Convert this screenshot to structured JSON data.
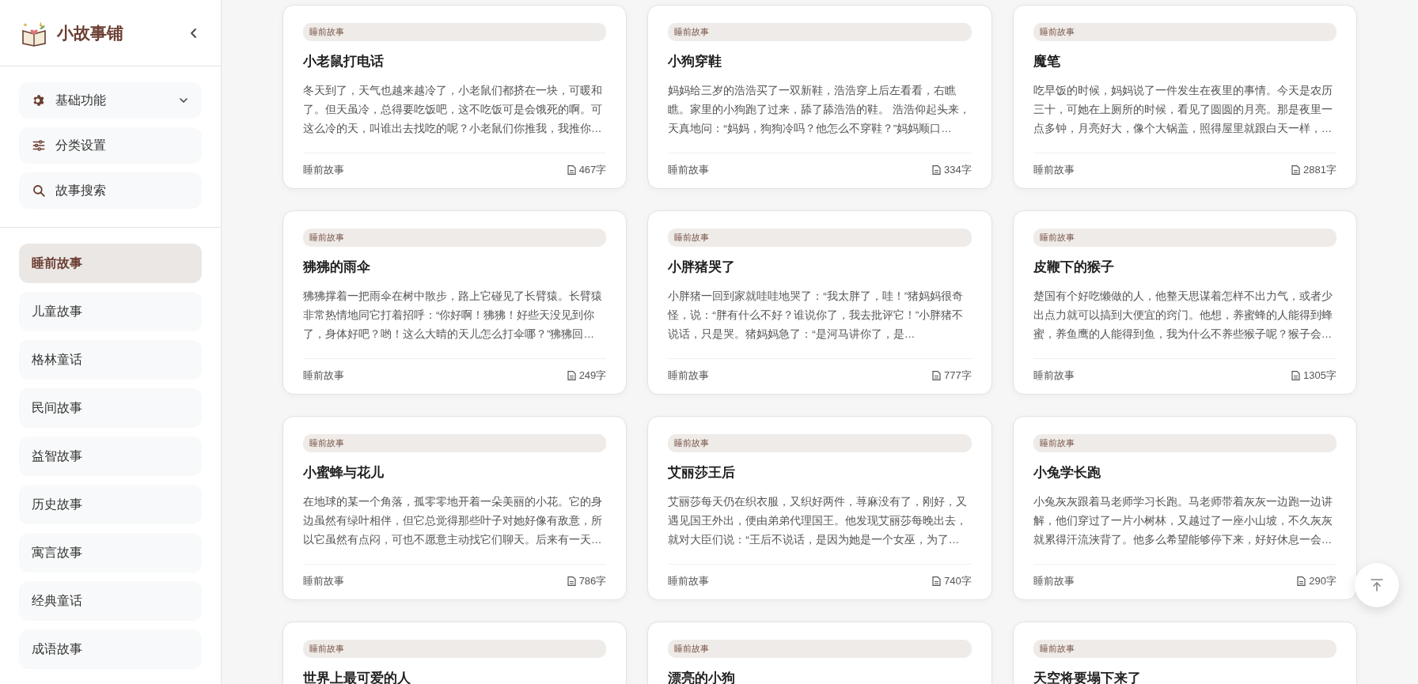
{
  "sidebar": {
    "brand": "小故事铺",
    "menu": [
      {
        "kind": "group",
        "label": "基础功能",
        "expanded": false
      },
      {
        "kind": "link",
        "label": "分类设置"
      },
      {
        "kind": "link",
        "label": "故事搜索"
      }
    ],
    "categories": [
      {
        "label": "睡前故事",
        "selected": true
      },
      {
        "label": "儿童故事",
        "selected": false
      },
      {
        "label": "格林童话",
        "selected": false
      },
      {
        "label": "民间故事",
        "selected": false
      },
      {
        "label": "益智故事",
        "selected": false
      },
      {
        "label": "历史故事",
        "selected": false
      },
      {
        "label": "寓言故事",
        "selected": false
      },
      {
        "label": "经典童话",
        "selected": false
      },
      {
        "label": "成语故事",
        "selected": false
      }
    ]
  },
  "stories": [
    {
      "tag": "睡前故事",
      "title": "小老鼠打电话",
      "excerpt": "冬天到了，天气也越来越冷了，小老鼠们都挤在一块，可暖和了。但天虽冷，总得要吃饭吧，这不吃饭可是会饿死的啊。可这么冷的天，叫谁出去找吃的呢？小老鼠们你推我，我推你…",
      "category": "睡前故事",
      "word_count": "467字"
    },
    {
      "tag": "睡前故事",
      "title": "小狗穿鞋",
      "excerpt": "妈妈给三岁的浩浩买了一双新鞋，浩浩穿上后左看看，右瞧瞧。家里的小狗跑了过来，舔了舔浩浩的鞋。 浩浩仰起头来，天真地问：“妈妈，狗狗冷吗？他怎么不穿鞋？”妈妈顺口…",
      "category": "睡前故事",
      "word_count": "334字"
    },
    {
      "tag": "睡前故事",
      "title": "魔笔",
      "excerpt": "吃早饭的时候，妈妈说了一件发生在夜里的事情。今天是农历三十，可她在上厕所的时候，看见了圆圆的月亮。那是夜里一点多钟，月亮好大，像个大锅盖，照得屋里就跟白天一样，…",
      "category": "睡前故事",
      "word_count": "2881字"
    },
    {
      "tag": "睡前故事",
      "title": "狒狒的雨伞",
      "excerpt": "狒狒撑着一把雨伞在树中散步，路上它碰见了长臂猿。长臂猿非常热情地同它打着招呼：“你好啊！狒狒！好些天没见到你了，身体好吧？哟！这么大晴的天儿怎么打伞哪？”狒狒回…",
      "category": "睡前故事",
      "word_count": "249字"
    },
    {
      "tag": "睡前故事",
      "title": "小胖猪哭了",
      "excerpt": "小胖猪一回到家就哇哇地哭了：“我太胖了，哇！”猪妈妈很奇怪，说：“胖有什么不好？谁说你了，我去批评它！”小胖猪不说话，只是哭。猪妈妈急了：“是河马讲你了，是…",
      "category": "睡前故事",
      "word_count": "777字"
    },
    {
      "tag": "睡前故事",
      "title": "皮鞭下的猴子",
      "excerpt": "楚国有个好吃懒做的人，他整天思谋着怎样不出力气，或者少出点力就可以搞到大便宜的窍门。他想，养蜜蜂的人能得到蜂蜜，养鱼鹰的人能得到鱼，我为什么不养些猴子呢？猴子会…",
      "category": "睡前故事",
      "word_count": "1305字"
    },
    {
      "tag": "睡前故事",
      "title": "小蜜蜂与花儿",
      "excerpt": "在地球的某一个角落，孤零零地开着一朵美丽的小花。它的身边虽然有绿叶相伴，但它总觉得那些叶子对她好像有敌意，所以它虽然有点闷，可也不愿意主动找它们聊天。后来有一天…",
      "category": "睡前故事",
      "word_count": "786字"
    },
    {
      "tag": "睡前故事",
      "title": "艾丽莎王后",
      "excerpt": "艾丽莎每天仍在织衣服，又织好两件，荨麻没有了，刚好，又遇见国王外出，便由弟弟代理国王。他发现艾丽莎每晚出去，就对大臣们说：“王后不说话，是因为她是一个女巫，为了…",
      "category": "睡前故事",
      "word_count": "740字"
    },
    {
      "tag": "睡前故事",
      "title": "小兔学长跑",
      "excerpt": "小兔灰灰跟着马老师学习长跑。马老师带着灰灰一边跑一边讲解，他们穿过了一片小树林，又越过了一座小山坡，不久灰灰就累得汗流浃背了。他多么希望能够停下来，好好休息一会…",
      "category": "睡前故事",
      "word_count": "290字"
    },
    {
      "tag": "睡前故事",
      "title": "世界上最可爱的人"
    },
    {
      "tag": "睡前故事",
      "title": "漂亮的小狗"
    },
    {
      "tag": "睡前故事",
      "title": "天空将要塌下来了"
    }
  ]
}
